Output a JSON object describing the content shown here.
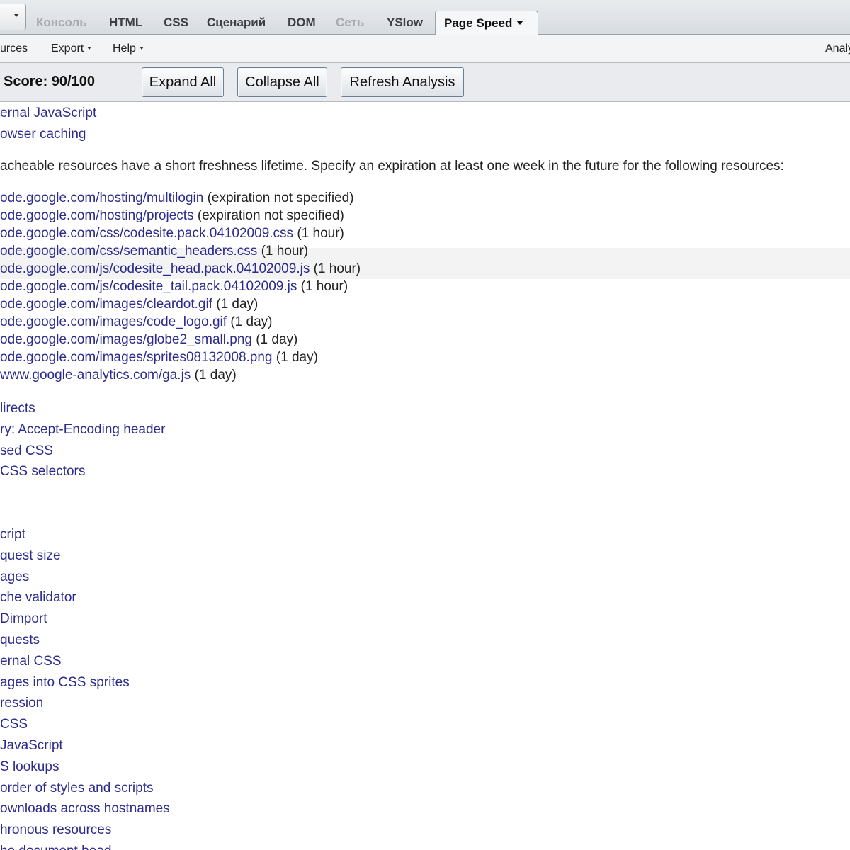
{
  "tabs": [
    {
      "label": "Консоль",
      "state": "disabled"
    },
    {
      "label": "HTML",
      "state": "normal"
    },
    {
      "label": "CSS",
      "state": "normal"
    },
    {
      "label": "Сценарий",
      "state": "normal"
    },
    {
      "label": "DOM",
      "state": "normal"
    },
    {
      "label": "Сеть",
      "state": "disabled"
    },
    {
      "label": "YSlow",
      "state": "normal"
    },
    {
      "label": "Page Speed",
      "state": "active"
    }
  ],
  "menubar": {
    "resources_label": "urces",
    "export_label": "Export",
    "help_label": "Help",
    "analyze_label": "Analy"
  },
  "toolbar": {
    "score": "Score: 90/100",
    "expand_all": "Expand All",
    "collapse_all": "Collapse All",
    "refresh_analysis": "Refresh Analysis"
  },
  "rules_top": [
    "ernal JavaScript",
    "owser caching"
  ],
  "detail": {
    "text": "acheable resources have a short freshness lifetime. Specify an expiration at least one week in the future for the following resources:"
  },
  "resources": [
    {
      "url": "ode.google.com/hosting/multilogin",
      "note": "(expiration not specified)"
    },
    {
      "url": "ode.google.com/hosting/projects",
      "note": "(expiration not specified)"
    },
    {
      "url": "ode.google.com/css/codesite.pack.04102009.css",
      "note": "(1 hour)"
    },
    {
      "url": "ode.google.com/css/semantic_headers.css",
      "note": "(1 hour)"
    },
    {
      "url": "ode.google.com/js/codesite_head.pack.04102009.js",
      "note": "(1 hour)"
    },
    {
      "url": "ode.google.com/js/codesite_tail.pack.04102009.js",
      "note": "(1 hour)"
    },
    {
      "url": "ode.google.com/images/cleardot.gif",
      "note": "(1 day)"
    },
    {
      "url": "ode.google.com/images/code_logo.gif",
      "note": "(1 day)"
    },
    {
      "url": "ode.google.com/images/globe2_small.png",
      "note": "(1 day)"
    },
    {
      "url": "ode.google.com/images/sprites08132008.png",
      "note": "(1 day)"
    },
    {
      "url": "www.google-analytics.com/ga.js",
      "note": "(1 day)"
    }
  ],
  "rules_mid": [
    "lirects",
    "ry: Accept-Encoding header",
    "sed CSS",
    " CSS selectors"
  ],
  "rules_bottom": [
    "cript",
    "quest size",
    "ages",
    "che validator",
    "Dimport",
    "quests",
    "ernal CSS",
    "ages into CSS sprites",
    "ression",
    "CSS",
    "JavaScript",
    "S lookups",
    " order of styles and scripts",
    "ownloads across hostnames",
    "hronous resources",
    "he document head"
  ]
}
